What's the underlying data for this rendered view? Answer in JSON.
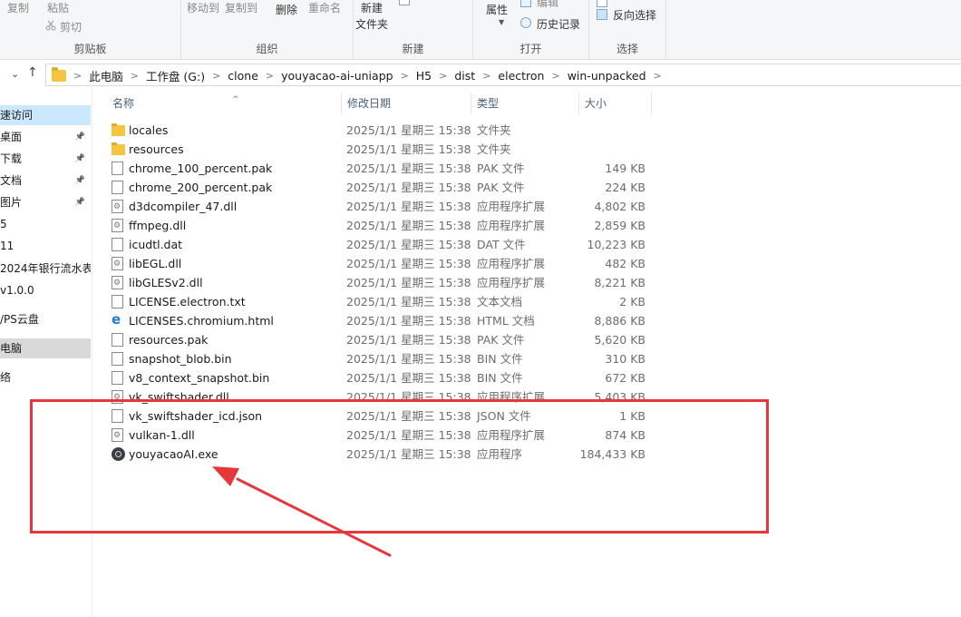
{
  "ribbon": {
    "clipboard": {
      "copy": "复制",
      "paste": "粘贴",
      "cut": "剪切",
      "title": "剪贴板"
    },
    "organize": {
      "move_to": "移动到",
      "copy_to": "复制到",
      "delete": "删除",
      "rename": "重命名",
      "title": "组织"
    },
    "new": {
      "new_folder_line1": "新建",
      "new_folder_line2": "文件夹",
      "title": "新建"
    },
    "open": {
      "properties": "属性",
      "edit": "编辑",
      "history": "历史记录",
      "title": "打开"
    },
    "select": {
      "invert": "反向选择",
      "title": "选择"
    }
  },
  "address": {
    "crumbs": [
      "此电脑",
      "工作盘 (G:)",
      "clone",
      "youyacao-ai-uniapp",
      "H5",
      "dist",
      "electron",
      "win-unpacked"
    ]
  },
  "sidebar": {
    "items": [
      {
        "label": "速访问"
      },
      {
        "label": "桌面"
      },
      {
        "label": "下载"
      },
      {
        "label": "文档"
      },
      {
        "label": "图片"
      },
      {
        "label": "5"
      },
      {
        "label": "11"
      },
      {
        "label": "2024年银行流水表"
      },
      {
        "label": "v1.0.0"
      },
      {
        "label": "/PS云盘"
      },
      {
        "label": "电脑"
      },
      {
        "label": "络"
      }
    ]
  },
  "columns": {
    "name": "名称",
    "date": "修改日期",
    "type": "类型",
    "size": "大小"
  },
  "files": [
    {
      "icon": "folder-icon",
      "name": "locales",
      "date": "2025/1/1 星期三 15:38",
      "type": "文件夹",
      "size": ""
    },
    {
      "icon": "folder-icon",
      "name": "resources",
      "date": "2025/1/1 星期三 15:38",
      "type": "文件夹",
      "size": ""
    },
    {
      "icon": "file-icon",
      "name": "chrome_100_percent.pak",
      "date": "2025/1/1 星期三 15:38",
      "type": "PAK 文件",
      "size": "149 KB"
    },
    {
      "icon": "file-icon",
      "name": "chrome_200_percent.pak",
      "date": "2025/1/1 星期三 15:38",
      "type": "PAK 文件",
      "size": "224 KB"
    },
    {
      "icon": "dll-icon",
      "name": "d3dcompiler_47.dll",
      "date": "2025/1/1 星期三 15:38",
      "type": "应用程序扩展",
      "size": "4,802 KB"
    },
    {
      "icon": "dll-icon",
      "name": "ffmpeg.dll",
      "date": "2025/1/1 星期三 15:38",
      "type": "应用程序扩展",
      "size": "2,859 KB"
    },
    {
      "icon": "file-icon",
      "name": "icudtl.dat",
      "date": "2025/1/1 星期三 15:38",
      "type": "DAT 文件",
      "size": "10,223 KB"
    },
    {
      "icon": "dll-icon",
      "name": "libEGL.dll",
      "date": "2025/1/1 星期三 15:38",
      "type": "应用程序扩展",
      "size": "482 KB"
    },
    {
      "icon": "dll-icon",
      "name": "libGLESv2.dll",
      "date": "2025/1/1 星期三 15:38",
      "type": "应用程序扩展",
      "size": "8,221 KB"
    },
    {
      "icon": "text-file-icon",
      "name": "LICENSE.electron.txt",
      "date": "2025/1/1 星期三 15:38",
      "type": "文本文档",
      "size": "2 KB"
    },
    {
      "icon": "html-file-icon",
      "name": "LICENSES.chromium.html",
      "date": "2025/1/1 星期三 15:38",
      "type": "HTML 文档",
      "size": "8,886 KB"
    },
    {
      "icon": "file-icon",
      "name": "resources.pak",
      "date": "2025/1/1 星期三 15:38",
      "type": "PAK 文件",
      "size": "5,620 KB"
    },
    {
      "icon": "file-icon",
      "name": "snapshot_blob.bin",
      "date": "2025/1/1 星期三 15:38",
      "type": "BIN 文件",
      "size": "310 KB"
    },
    {
      "icon": "file-icon",
      "name": "v8_context_snapshot.bin",
      "date": "2025/1/1 星期三 15:38",
      "type": "BIN 文件",
      "size": "672 KB"
    },
    {
      "icon": "dll-icon",
      "name": "vk_swiftshader.dll",
      "date": "2025/1/1 星期三 15:38",
      "type": "应用程序扩展",
      "size": "5,403 KB"
    },
    {
      "icon": "file-icon",
      "name": "vk_swiftshader_icd.json",
      "date": "2025/1/1 星期三 15:38",
      "type": "JSON 文件",
      "size": "1 KB"
    },
    {
      "icon": "dll-icon",
      "name": "vulkan-1.dll",
      "date": "2025/1/1 星期三 15:38",
      "type": "应用程序扩展",
      "size": "874 KB"
    },
    {
      "icon": "exe-icon",
      "name": "youyacaoAI.exe",
      "date": "2025/1/1 星期三 15:38",
      "type": "应用程序",
      "size": "184,433 KB"
    }
  ],
  "annotation": {
    "color": "#e8373c"
  }
}
